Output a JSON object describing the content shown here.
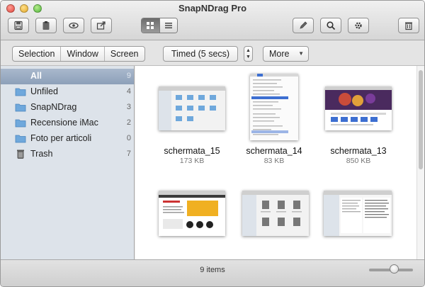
{
  "window": {
    "title": "SnapNDrag Pro"
  },
  "toolbar": {
    "buttons": [
      {
        "name": "save-button",
        "icon": "save-icon"
      },
      {
        "name": "trash-capture-button",
        "icon": "clipboard-icon"
      },
      {
        "name": "preview-button",
        "icon": "eye-icon"
      },
      {
        "name": "share-button",
        "icon": "share-icon"
      },
      {
        "name": "edit-button",
        "icon": "pencil-icon"
      },
      {
        "name": "search-button",
        "icon": "search-icon"
      },
      {
        "name": "settings-button",
        "icon": "gear-icon"
      },
      {
        "name": "delete-button",
        "icon": "trash-icon"
      }
    ],
    "view_mode": "grid"
  },
  "capture": {
    "modes": [
      "Selection",
      "Window",
      "Screen"
    ],
    "timed_label": "Timed (5 secs)",
    "more_label": "More"
  },
  "sidebar": {
    "items": [
      {
        "label": "All",
        "count": "9",
        "icon": "all-icon",
        "selected": true
      },
      {
        "label": "Unfiled",
        "count": "4",
        "icon": "folder-icon"
      },
      {
        "label": "SnapNDrag",
        "count": "3",
        "icon": "folder-icon"
      },
      {
        "label": "Recensione iMac",
        "count": "2",
        "icon": "folder-icon"
      },
      {
        "label": "Foto per articoli",
        "count": "0",
        "icon": "folder-icon"
      },
      {
        "label": "Trash",
        "count": "7",
        "icon": "trash-icon"
      }
    ]
  },
  "grid": {
    "items": [
      {
        "name": "schermata_15",
        "size": "173 KB"
      },
      {
        "name": "schermata_14",
        "size": "83 KB"
      },
      {
        "name": "schermata_13",
        "size": "850 KB"
      },
      {
        "name": "",
        "size": ""
      },
      {
        "name": "",
        "size": ""
      },
      {
        "name": "",
        "size": ""
      }
    ]
  },
  "status": {
    "items_label": "9 items",
    "zoom_level": 0.55
  },
  "colors": {
    "selection": "#9aabc2",
    "sidebar_bg": "#dde3ea",
    "folder": "#6fa8dc"
  }
}
